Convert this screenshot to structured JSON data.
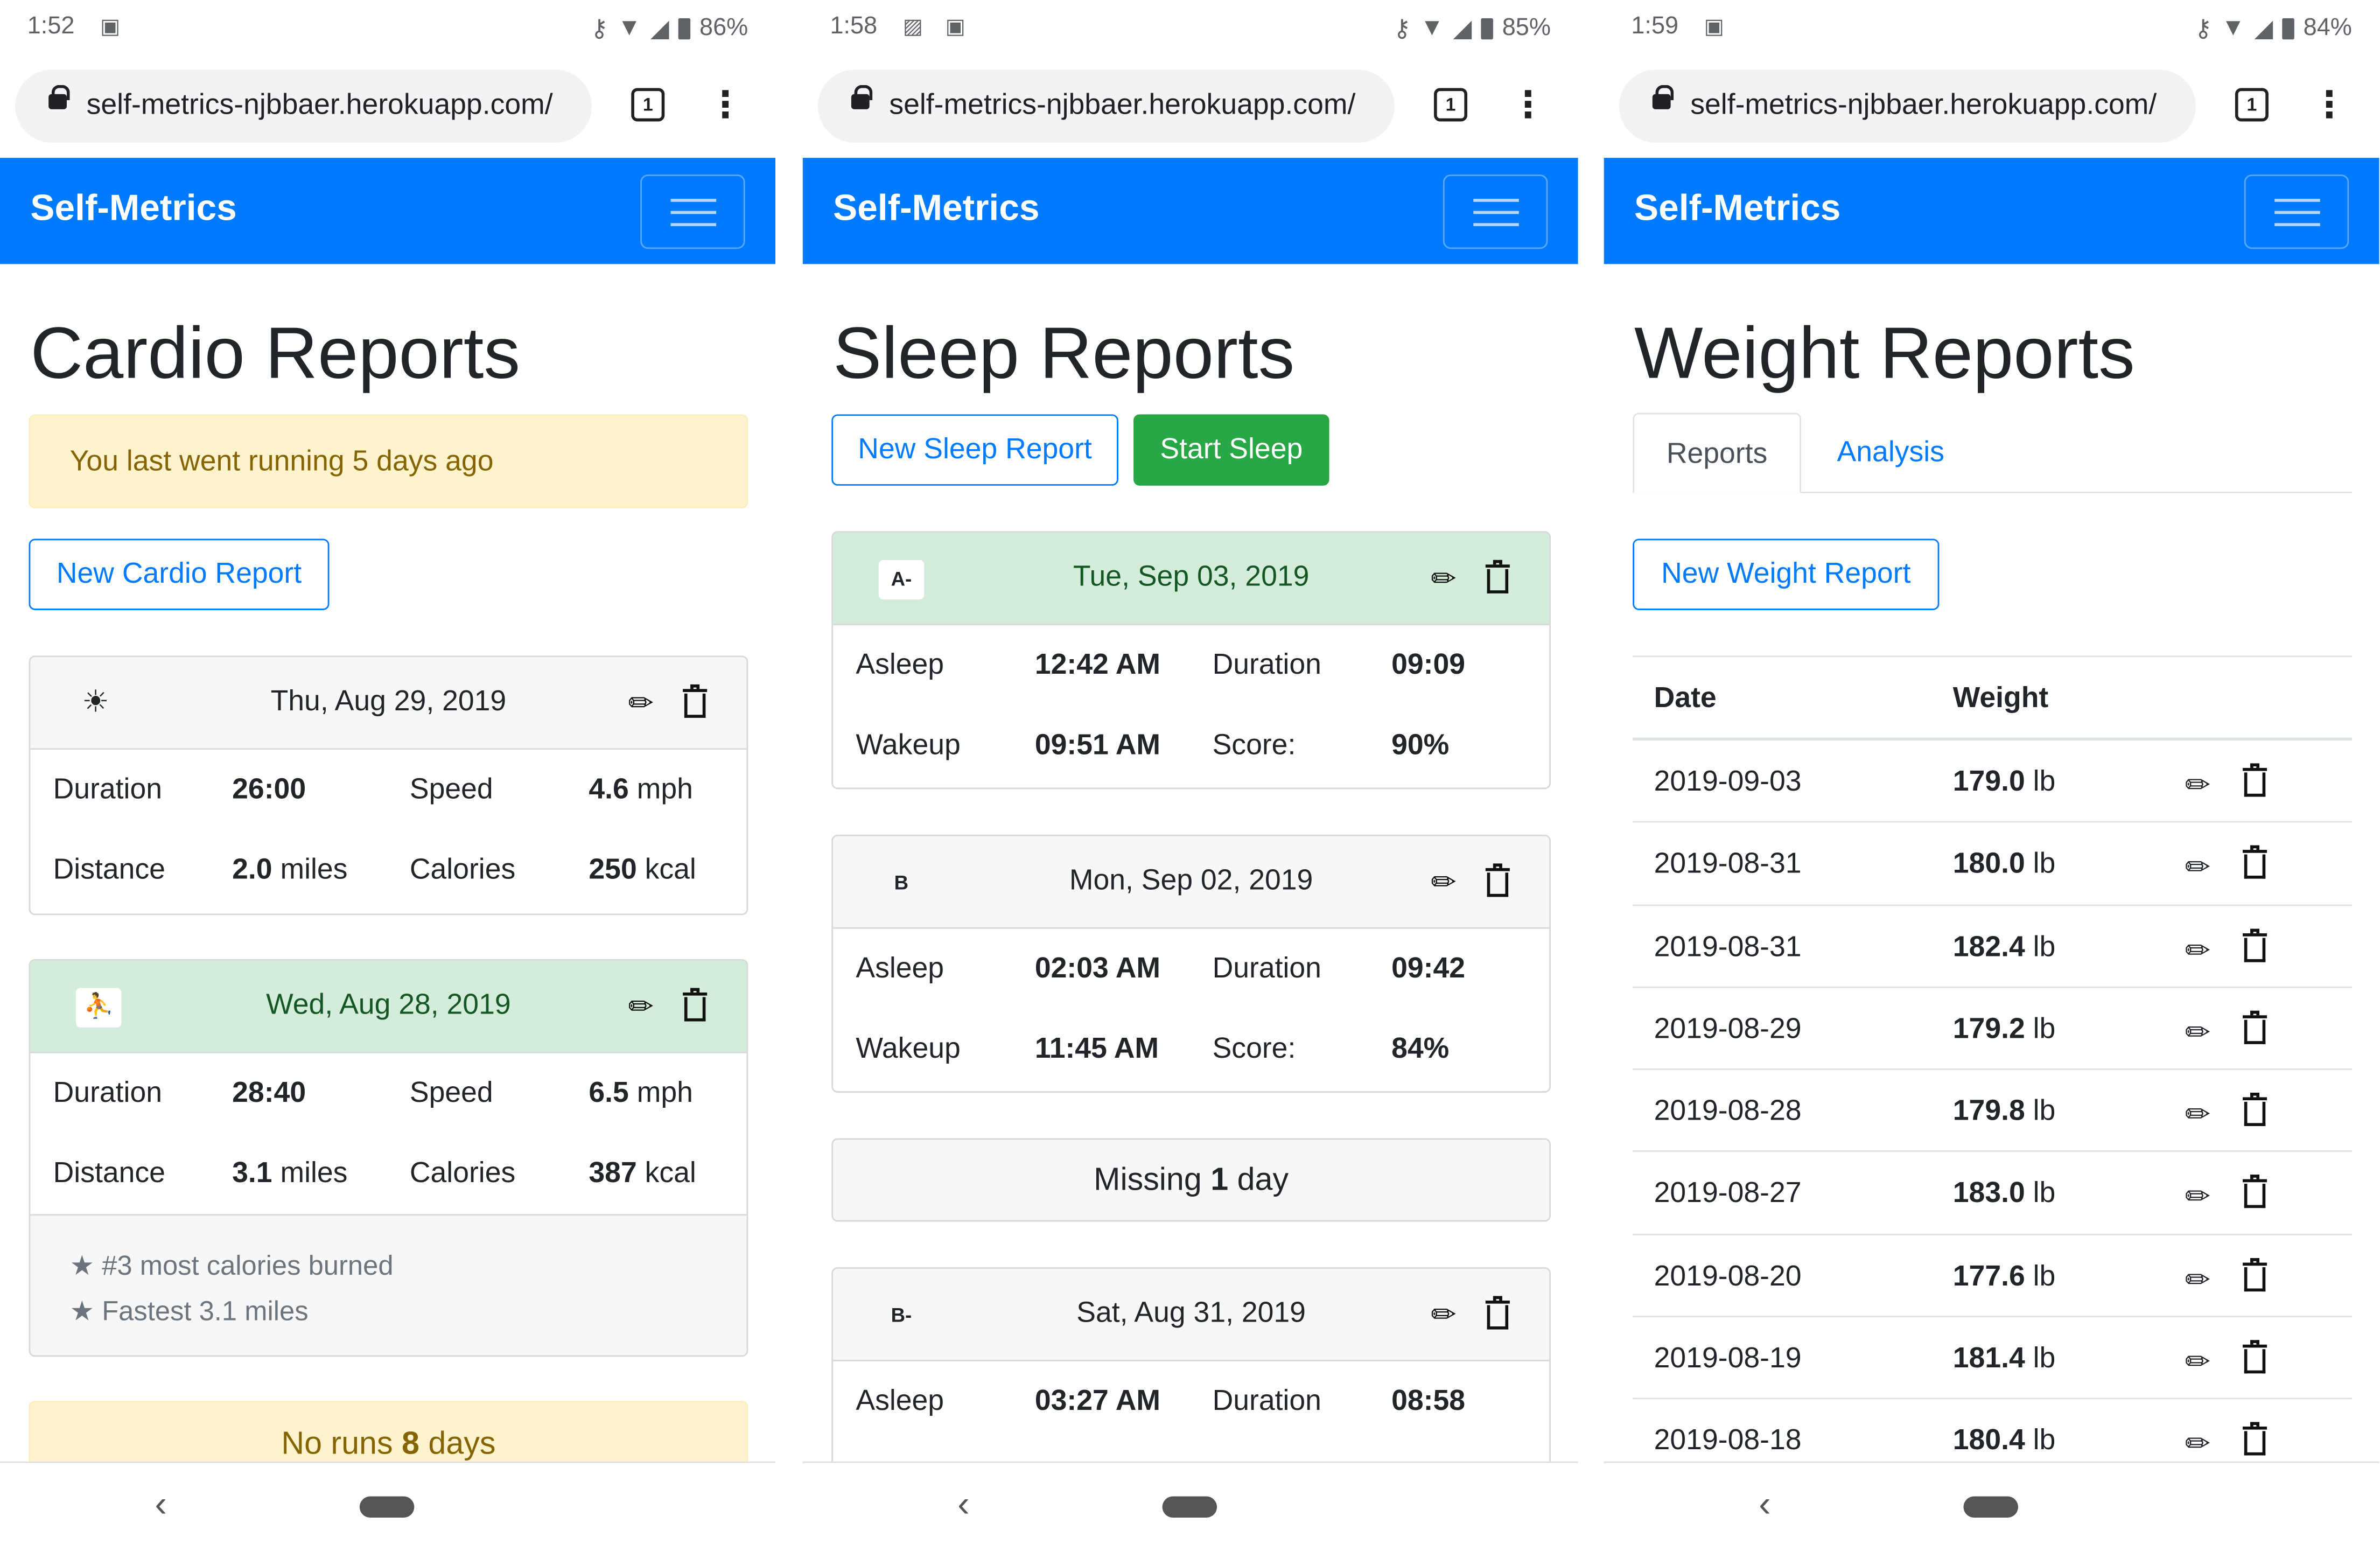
{
  "screens": [
    {
      "status": {
        "time": "1:52",
        "battery": "86%"
      },
      "browser": {
        "url": "self-metrics-njbbaer.herokuapp.com/",
        "tab_count": "1"
      },
      "navbar": {
        "brand": "Self-Metrics"
      },
      "title": "Cardio Reports",
      "alert": "You last went running 5 days ago",
      "new_button": "New Cardio Report",
      "cards": [
        {
          "icon": "sun-icon",
          "icon_glyph": "☀",
          "date": "Thu, Aug 29, 2019",
          "rows": [
            {
              "l1": "Duration",
              "v1": "26:00",
              "u1": "",
              "l2": "Speed",
              "v2": "4.6",
              "u2": "mph"
            },
            {
              "l1": "Distance",
              "v1": "2.0",
              "u1": "miles",
              "l2": "Calories",
              "v2": "250",
              "u2": "kcal"
            }
          ]
        },
        {
          "icon": "treadmill-icon",
          "icon_glyph": "⛹",
          "date": "Wed, Aug 28, 2019",
          "rows": [
            {
              "l1": "Duration",
              "v1": "28:40",
              "u1": "",
              "l2": "Speed",
              "v2": "6.5",
              "u2": "mph"
            },
            {
              "l1": "Distance",
              "v1": "3.1",
              "u1": "miles",
              "l2": "Calories",
              "v2": "387",
              "u2": "kcal"
            }
          ],
          "notes": [
            "★ #3 most calories burned",
            "★ Fastest 3.1 miles"
          ]
        }
      ],
      "no_runs": {
        "pre": "No runs",
        "count": "8",
        "post": "days"
      }
    },
    {
      "status": {
        "time": "1:58",
        "battery": "85%"
      },
      "browser": {
        "url": "self-metrics-njbbaer.herokuapp.com/",
        "tab_count": "1"
      },
      "navbar": {
        "brand": "Self-Metrics"
      },
      "title": "Sleep Reports",
      "new_button": "New Sleep Report",
      "start_button": "Start Sleep",
      "cards": [
        {
          "grade": "A-",
          "date": "Tue, Sep 03, 2019",
          "rows": [
            {
              "l1": "Asleep",
              "v1": "12:42 AM",
              "l2": "Duration",
              "v2": "09:09"
            },
            {
              "l1": "Wakeup",
              "v1": "09:51 AM",
              "l2": "Score:",
              "v2": "90%"
            }
          ]
        },
        {
          "grade": "B",
          "date": "Mon, Sep 02, 2019",
          "rows": [
            {
              "l1": "Asleep",
              "v1": "02:03 AM",
              "l2": "Duration",
              "v2": "09:42"
            },
            {
              "l1": "Wakeup",
              "v1": "11:45 AM",
              "l2": "Score:",
              "v2": "84%"
            }
          ]
        },
        {
          "grade": "B-",
          "date": "Sat, Aug 31, 2019",
          "rows": [
            {
              "l1": "Asleep",
              "v1": "03:27 AM",
              "l2": "Duration",
              "v2": "08:58"
            }
          ]
        }
      ],
      "missing": {
        "pre": "Missing",
        "count": "1",
        "post": "day"
      }
    },
    {
      "status": {
        "time": "1:59",
        "battery": "84%"
      },
      "browser": {
        "url": "self-metrics-njbbaer.herokuapp.com/",
        "tab_count": "1"
      },
      "navbar": {
        "brand": "Self-Metrics"
      },
      "title": "Weight Reports",
      "tabs": [
        "Reports",
        "Analysis"
      ],
      "new_button": "New Weight Report",
      "table": {
        "headers": [
          "Date",
          "Weight"
        ],
        "unit": "lb",
        "rows": [
          {
            "date": "2019-09-03",
            "weight": "179.0"
          },
          {
            "date": "2019-08-31",
            "weight": "180.0"
          },
          {
            "date": "2019-08-31",
            "weight": "182.4"
          },
          {
            "date": "2019-08-29",
            "weight": "179.2"
          },
          {
            "date": "2019-08-28",
            "weight": "179.8"
          },
          {
            "date": "2019-08-27",
            "weight": "183.0"
          },
          {
            "date": "2019-08-20",
            "weight": "177.6"
          },
          {
            "date": "2019-08-19",
            "weight": "181.4"
          },
          {
            "date": "2019-08-18",
            "weight": "180.4"
          }
        ]
      }
    }
  ],
  "colors": {
    "primary": "#007bff",
    "success": "#28a745",
    "warning_bg": "#fff3cd",
    "warning_text": "#856404",
    "success_bg": "#d4edda"
  }
}
